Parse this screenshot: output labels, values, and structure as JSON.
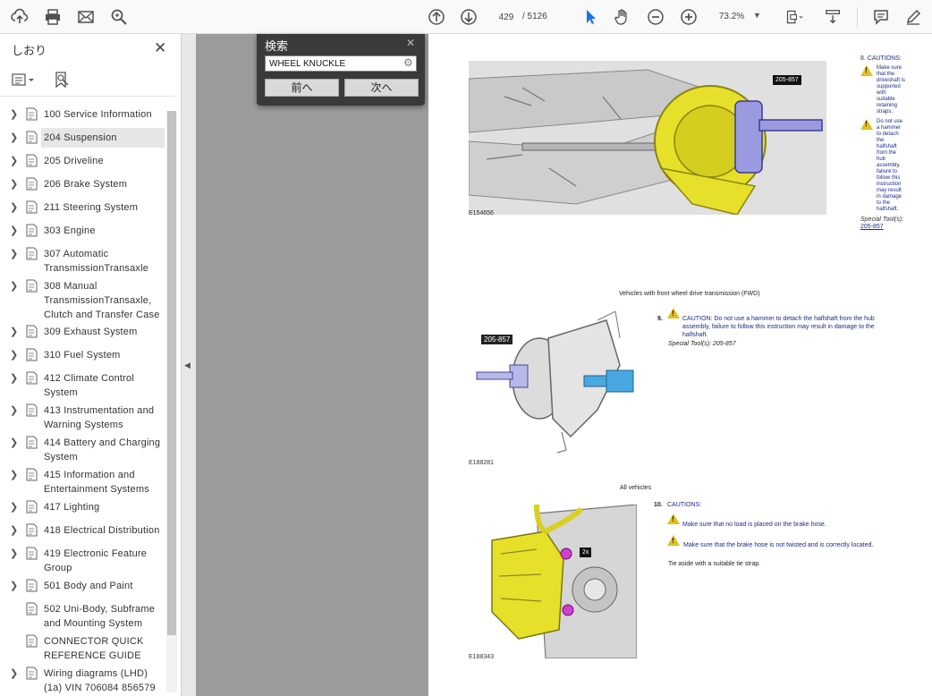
{
  "toolbar": {
    "current_page": "429",
    "page_total": "/ 5126",
    "zoom": "73.2%"
  },
  "sidebar": {
    "title": "しおり",
    "items": [
      {
        "label": "100 Service Information",
        "expandable": true
      },
      {
        "label": "204 Suspension",
        "expandable": true,
        "selected": true
      },
      {
        "label": "205 Driveline",
        "expandable": true
      },
      {
        "label": "206 Brake System",
        "expandable": true
      },
      {
        "label": "211 Steering System",
        "expandable": true
      },
      {
        "label": "303 Engine",
        "expandable": true
      },
      {
        "label": "307 Automatic TransmissionTransaxle",
        "expandable": true
      },
      {
        "label": "308 Manual TransmissionTransaxle, Clutch and Transfer Case",
        "expandable": true
      },
      {
        "label": "309 Exhaust System",
        "expandable": true
      },
      {
        "label": "310 Fuel System",
        "expandable": true
      },
      {
        "label": "412 Climate Control System",
        "expandable": true
      },
      {
        "label": "413 Instrumentation and Warning Systems",
        "expandable": true
      },
      {
        "label": "414 Battery and Charging System",
        "expandable": true
      },
      {
        "label": "415 Information and Entertainment Systems",
        "expandable": true
      },
      {
        "label": "417 Lighting",
        "expandable": true
      },
      {
        "label": "418 Electrical Distribution",
        "expandable": true
      },
      {
        "label": "419 Electronic Feature Group",
        "expandable": true
      },
      {
        "label": "501 Body and Paint",
        "expandable": true
      },
      {
        "label": "502 Uni-Body, Subframe and Mounting System",
        "expandable": false
      },
      {
        "label": "CONNECTOR QUICK REFERENCE GUIDE",
        "expandable": false
      },
      {
        "label": "Wiring diagrams (LHD) (1a) VIN 706084 856579",
        "expandable": true
      }
    ]
  },
  "search": {
    "title": "検索",
    "query": "WHEEL KNUCKLE",
    "prev_label": "前へ",
    "next_label": "次へ"
  },
  "document": {
    "fig1_code": "E154656",
    "fig1_callout": "205-857",
    "caution8_heading": "8. CAUTIONS:",
    "caution8_a": "Make sure that the driveshaft is supported with suitable retaining straps.",
    "caution8_b": "Do not use a hammer to detach the halfshaft from the hub assembly, failure to follow this instruction may result in damage to the halfshaft.",
    "special_tools_label": "Special Tool(s):",
    "special_tools_value": "205-857",
    "fwd_heading": "Vehicles with front wheel drive transmission (FWD)",
    "step9_num": "9.",
    "step9_text": "CAUTION: Do not use a hammer to detach the halfshaft from the hub assembly, failure to follow this instruction may result in damage to the halfshaft.",
    "step9_tools": "Special Tool(s): 205-857",
    "fig2_callout": "205-857",
    "fig2_code": "E188281",
    "all_vehicles_heading": "All vehicles",
    "step10_num": "10.",
    "step10_heading": "CAUTIONS:",
    "step10_a": "Make sure that no load is placed on the brake hose.",
    "step10_b": "Make sure that the brake hose is not twisted and is correctly located.",
    "step10_c": "Tie aside with a suitable tie strap.",
    "fig3_callout": "2x",
    "fig3_code": "E188343"
  },
  "colors": {
    "accent_yellow": "#e6e02a",
    "caution_blue": "#1b2b8a",
    "search_panel_bg": "#3a3a3a"
  }
}
